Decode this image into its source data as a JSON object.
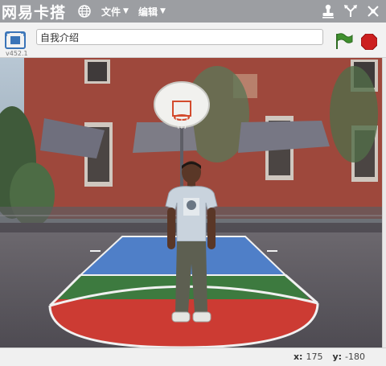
{
  "app": {
    "brand": "网易卡搭"
  },
  "menu": {
    "file_label": "文件",
    "edit_label": "编辑"
  },
  "stage_header": {
    "project_title": "自我介绍",
    "version": "v452.1"
  },
  "icons": {
    "globe": "globe-icon",
    "duplicate": "stamp-icon",
    "grow": "grow-arrows-icon",
    "shrink": "shrink-arrows-icon",
    "fullscreen": "fullscreen-icon",
    "green_flag": "green-flag-icon",
    "stop": "stop-sign-icon"
  },
  "colors": {
    "menubar": "#9c9ea2",
    "flag_green": "#3f8f2e",
    "stop_red": "#cc1f1f"
  },
  "footer": {
    "x_label": "x:",
    "x_value": "175",
    "y_label": "y:",
    "y_value": "-180"
  }
}
